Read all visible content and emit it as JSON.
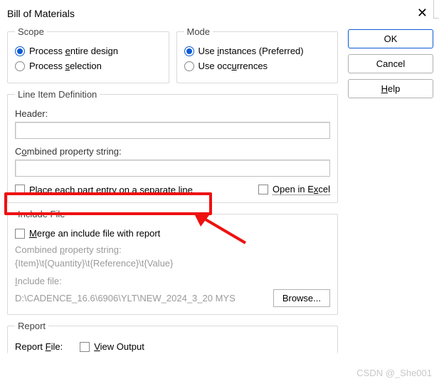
{
  "titlebar": {
    "title": "Bill of Materials"
  },
  "buttons": {
    "ok": "OK",
    "cancel": "Cancel",
    "help": "Help",
    "browse": "Browse..."
  },
  "scope": {
    "legend": "Scope",
    "opt1_pre": "Process ",
    "opt1_u": "e",
    "opt1_post": "ntire design",
    "opt2_pre": "Process ",
    "opt2_u": "s",
    "opt2_post": "election"
  },
  "mode": {
    "legend": "Mode",
    "opt1_pre": "Use ",
    "opt1_u": "i",
    "opt1_post": "nstances (Preferred)",
    "opt2_pre": "Use occ",
    "opt2_u": "u",
    "opt2_post": "rrences"
  },
  "lineitem": {
    "legend": "Line Item Definition",
    "header_label": "Header:",
    "header_value": "",
    "combined_label_pre": "C",
    "combined_label_u": "o",
    "combined_label_post": "mbined property string:",
    "combined_value": "",
    "sep_pre": "Place each part entry on a separate ",
    "sep_u": "l",
    "sep_post": "ine",
    "excel_pre": "Open in E",
    "excel_u": "x",
    "excel_post": "cel"
  },
  "include": {
    "legend": "Include File",
    "merge_u": "M",
    "merge_post": "erge an include file with report",
    "combined_pre": "Combined ",
    "combined_u": "p",
    "combined_post": "roperty string:",
    "combined_value": "{Item}\\t{Quantity}\\t{Reference}\\t{Value}",
    "file_u": "I",
    "file_post": "nclude file:",
    "file_value": "D:\\CADENCE_16.6\\6906\\YLT\\NEW_2024_3_20 MYS"
  },
  "report": {
    "legend": "Report",
    "file_pre": "Report ",
    "file_u": "F",
    "file_post": "ile:",
    "view_u": "V",
    "view_post": "iew Output"
  },
  "watermark": "CSDN @_She001"
}
